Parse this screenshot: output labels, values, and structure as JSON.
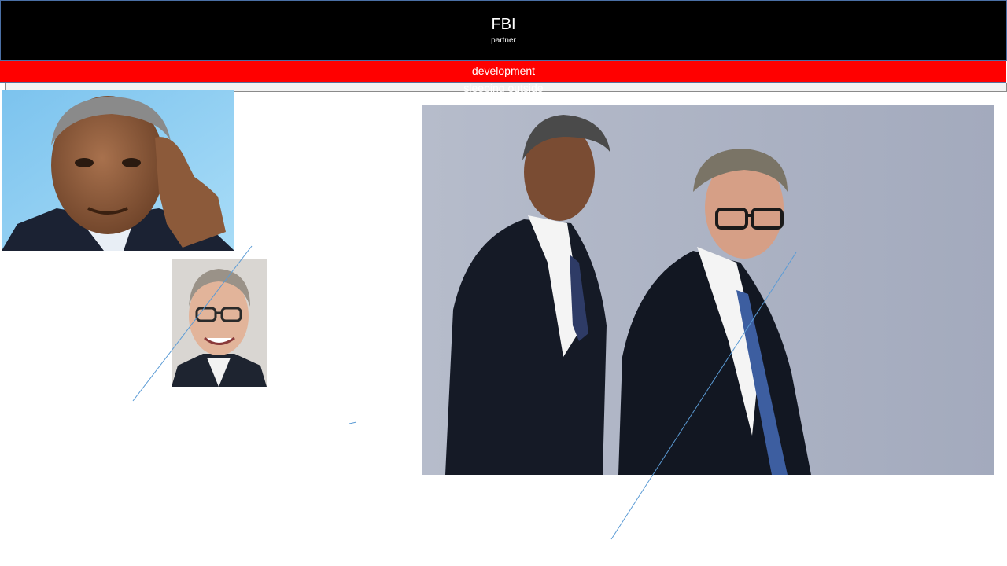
{
  "header": {
    "title": "FBI",
    "subtitle": "partner"
  },
  "banner": {
    "label": "development"
  },
  "subbanner": {
    "label": "sleeping outside"
  },
  "colors": {
    "header_background": "#000000",
    "banner_background": "#ff0000",
    "line_color": "#5b9bd5"
  }
}
